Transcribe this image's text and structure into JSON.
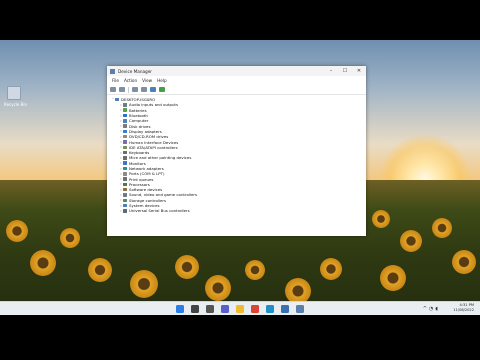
{
  "desktop": {
    "recycle_bin_label": "Recycle Bin"
  },
  "window": {
    "title": "Device Manager",
    "controls": {
      "minimize": "–",
      "maximize": "☐",
      "close": "✕"
    },
    "menu": [
      "File",
      "Action",
      "View",
      "Help"
    ],
    "root_node": "DESKTOP-ISG0RO",
    "devices": [
      {
        "label": "Audio inputs and outputs",
        "color": "#6b7b8c"
      },
      {
        "label": "Batteries",
        "color": "#58a34a"
      },
      {
        "label": "Bluetooth",
        "color": "#2f6fd0"
      },
      {
        "label": "Computer",
        "color": "#4d7fb8"
      },
      {
        "label": "Disk drives",
        "color": "#7a7a7a"
      },
      {
        "label": "Display adapters",
        "color": "#3a7bd5"
      },
      {
        "label": "DVD/CD-ROM drives",
        "color": "#8a8a8a"
      },
      {
        "label": "Human Interface Devices",
        "color": "#7e6aa8"
      },
      {
        "label": "IDE ATA/ATAPI controllers",
        "color": "#7a8f5c"
      },
      {
        "label": "Keyboards",
        "color": "#6c6c6c"
      },
      {
        "label": "Mice and other pointing devices",
        "color": "#6c6c6c"
      },
      {
        "label": "Monitors",
        "color": "#3c78c2"
      },
      {
        "label": "Network adapters",
        "color": "#2f8f9d"
      },
      {
        "label": "Ports (COM & LPT)",
        "color": "#8a8a8a"
      },
      {
        "label": "Print queues",
        "color": "#707070"
      },
      {
        "label": "Processors",
        "color": "#4a7a4a"
      },
      {
        "label": "Software devices",
        "color": "#8c6e44"
      },
      {
        "label": "Sound, video and game controllers",
        "color": "#6b7b8c"
      },
      {
        "label": "Storage controllers",
        "color": "#5a8a5a"
      },
      {
        "label": "System devices",
        "color": "#4d7fb8"
      },
      {
        "label": "Universal Serial Bus controllers",
        "color": "#5a6a7a"
      }
    ]
  },
  "taskbar": {
    "icons": [
      {
        "name": "start-icon",
        "color": "#2b7de9"
      },
      {
        "name": "search-icon",
        "color": "#444444"
      },
      {
        "name": "task-view-icon",
        "color": "#555555"
      },
      {
        "name": "chat-icon",
        "color": "#5b5fc7"
      },
      {
        "name": "file-explorer-icon",
        "color": "#f2b92c"
      },
      {
        "name": "chrome-icon",
        "color": "#db4437"
      },
      {
        "name": "edge-icon",
        "color": "#1f8fc9"
      },
      {
        "name": "store-icon",
        "color": "#3a6fb0"
      },
      {
        "name": "device-manager-icon",
        "color": "#5a7fa8"
      }
    ],
    "clock_time": "4:31 PM",
    "clock_date": "11/08/2022"
  }
}
